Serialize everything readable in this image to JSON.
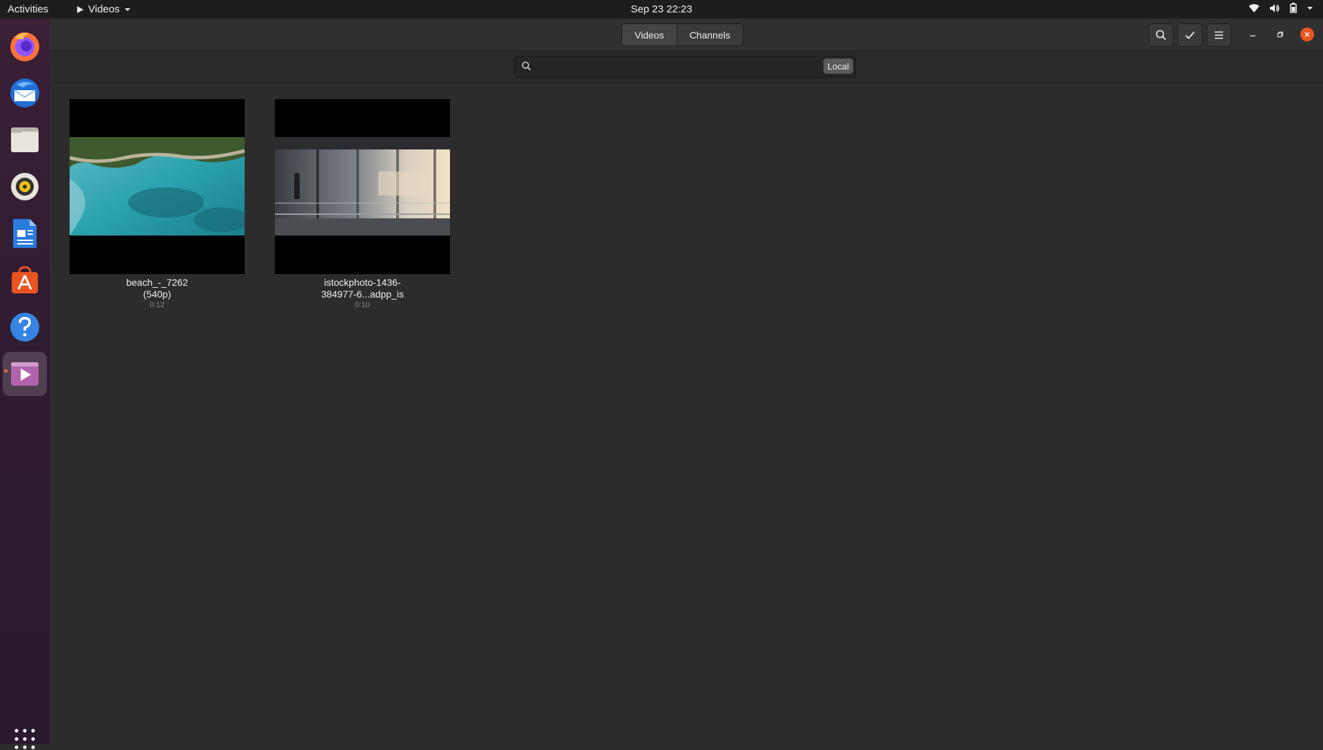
{
  "topbar": {
    "activities": "Activities",
    "app_name": "Videos",
    "clock": "Sep 23  22:23"
  },
  "dock": {
    "apps": [
      "Firefox",
      "Thunderbird Mail",
      "Files",
      "Rhythmbox",
      "LibreOffice Writer",
      "Ubuntu Software",
      "Help",
      "Videos"
    ],
    "active_app": "Videos"
  },
  "header": {
    "tabs": [
      {
        "label": "Videos",
        "selected": true
      },
      {
        "label": "Channels",
        "selected": false
      }
    ]
  },
  "search": {
    "value": "",
    "placeholder": "",
    "source_button": "Local"
  },
  "videos": [
    {
      "title": "beach_-_7262\n(540p)",
      "duration": "0:12",
      "thumbnail": "aerial-beach"
    },
    {
      "title": "istockphoto-1436-\n384977-6...adpp_is",
      "duration": "0:10",
      "thumbnail": "office-window"
    }
  ],
  "colors": {
    "accent": "#e95420",
    "window_bg": "#2c2c2c",
    "topbar_bg": "#1d1d1d"
  }
}
